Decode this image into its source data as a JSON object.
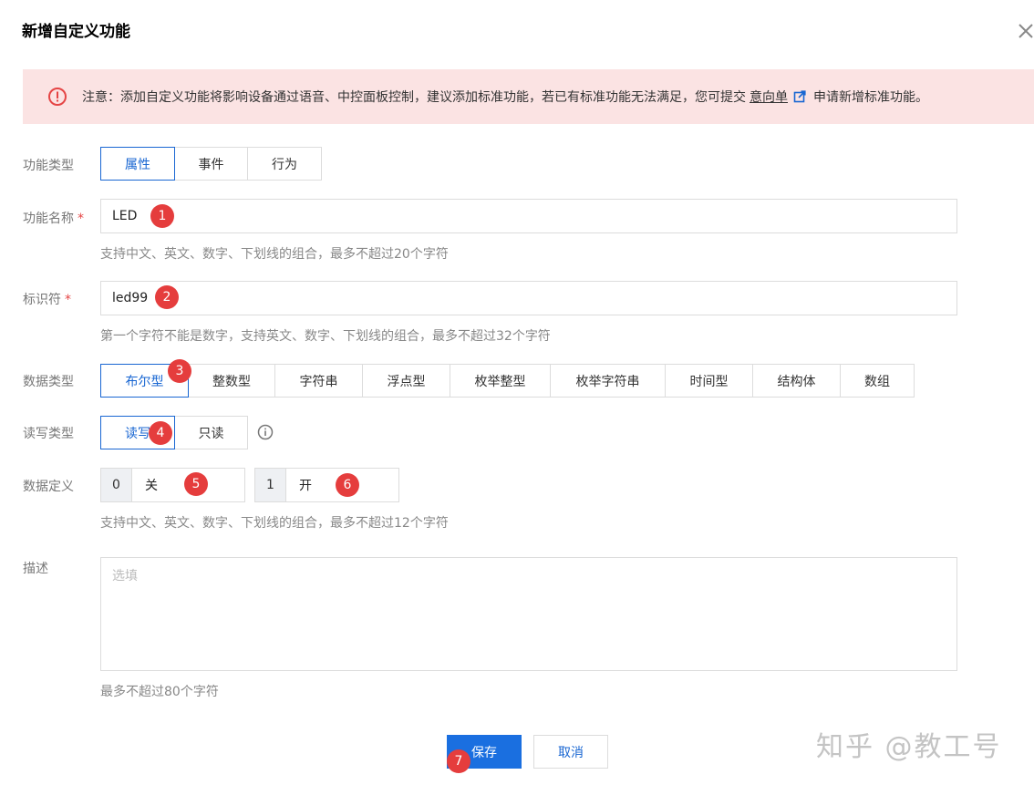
{
  "dialog": {
    "title": "新增自定义功能",
    "close_icon": "close-icon"
  },
  "notice": {
    "icon": "alert-circle-icon",
    "text": "注意：添加自定义功能将影响设备通过语音、中控面板控制，建议添加标准功能，若已有标准功能无法满足，您可提交",
    "link": "意向单",
    "link_icon": "external-link-icon",
    "suffix": "申请新增标准功能。",
    "bg_color": "#fbe3e3",
    "icon_color": "#e54545"
  },
  "function_type": {
    "label": "功能类型",
    "options": [
      "属性",
      "事件",
      "行为"
    ],
    "selected": "属性"
  },
  "function_name": {
    "label": "功能名称",
    "required_mark": "*",
    "value": "LED",
    "hint": "支持中文、英文、数字、下划线的组合，最多不超过20个字符"
  },
  "identifier": {
    "label": "标识符",
    "required_mark": "*",
    "value": "led99",
    "hint": "第一个字符不能是数字，支持英文、数字、下划线的组合，最多不超过32个字符"
  },
  "data_type": {
    "label": "数据类型",
    "options": [
      "布尔型",
      "整数型",
      "字符串",
      "浮点型",
      "枚举整型",
      "枚举字符串",
      "时间型",
      "结构体",
      "数组"
    ],
    "selected": "布尔型"
  },
  "rw_type": {
    "label": "读写类型",
    "options": [
      "读写",
      "只读"
    ],
    "selected": "读写",
    "info_icon": "info-icon"
  },
  "data_def": {
    "label": "数据定义",
    "items": [
      {
        "key": "0",
        "value": "关"
      },
      {
        "key": "1",
        "value": "开"
      }
    ],
    "hint": "支持中文、英文、数字、下划线的组合，最多不超过12个字符"
  },
  "description": {
    "label": "描述",
    "placeholder": "选填",
    "hint": "最多不超过80个字符"
  },
  "buttons": {
    "save": "保存",
    "cancel": "取消"
  },
  "badges": [
    "1",
    "2",
    "3",
    "4",
    "5",
    "6",
    "7"
  ],
  "watermark": "知乎 @教工号",
  "colors": {
    "primary": "#1a6fe0",
    "active_text": "#1866d2",
    "badge": "#e53d3d"
  }
}
